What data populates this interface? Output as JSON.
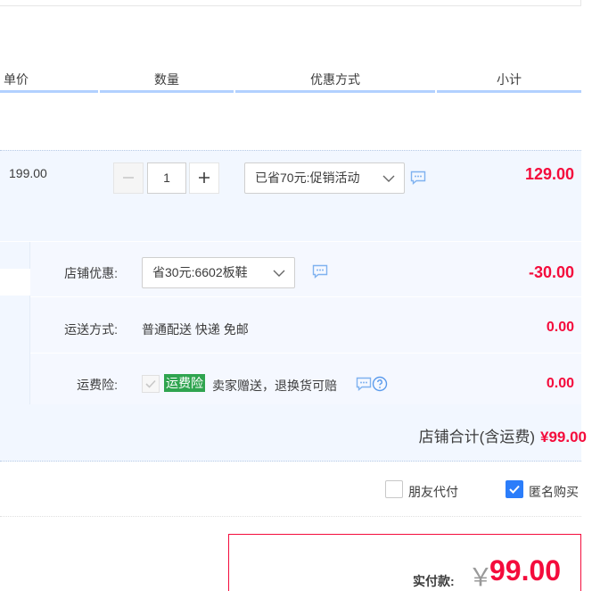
{
  "columns": {
    "unit_price": "单价",
    "quantity": "数量",
    "promotion": "优惠方式",
    "subtotal": "小计"
  },
  "item": {
    "unit_price": "199.00",
    "quantity": "1",
    "promotion": "已省70元:促销活动",
    "subtotal": "129.00"
  },
  "shop": {
    "coupon_label": "店铺优惠:",
    "coupon_value": "省30元:6602板鞋",
    "coupon_amount": "-30.00",
    "shipping_label": "运送方式:",
    "shipping_value": "普通配送 快递 免邮",
    "shipping_amount": "0.00",
    "insurance_label": "运费险:",
    "insurance_tag": "运费险",
    "insurance_text": "卖家赠送，退换货可赔",
    "insurance_amount": "0.00",
    "total_label": "店铺合计(含运费)",
    "total_amount": "¥99.00"
  },
  "options": {
    "friend_pay": "朋友代付",
    "friend_pay_checked": false,
    "anonymous": "匿名购买",
    "anonymous_checked": true
  },
  "payment": {
    "label": "实付款:",
    "currency": "￥",
    "amount": "99.00"
  },
  "colors": {
    "accent_red": "#f40c3c",
    "accent_blue": "#2b7dfa",
    "tag_green": "#2fa44f",
    "row_bg": "#f2f7ff"
  },
  "icons": [
    "minus-icon",
    "plus-icon",
    "chevron-down-icon",
    "chat-icon",
    "help-icon",
    "checkmark-icon"
  ]
}
